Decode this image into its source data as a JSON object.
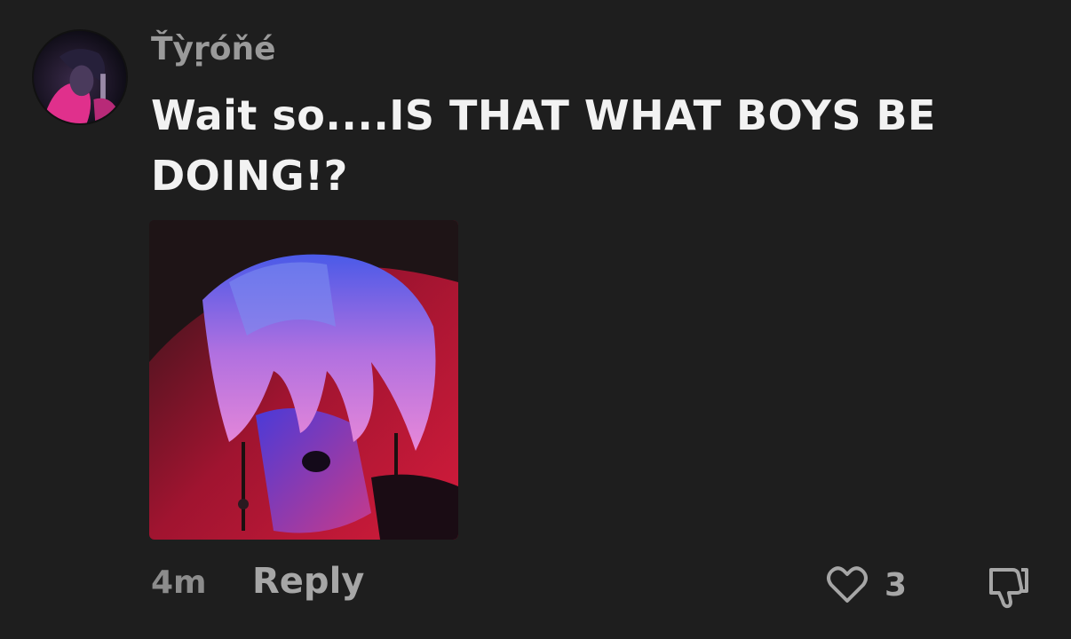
{
  "comment": {
    "username": "Ťỳṛóňé",
    "text": "Wait so....IS THAT WHAT BOYS BE DOING!?",
    "time": "4m",
    "reply_label": "Reply",
    "like_count": "3",
    "avatar_icon": "user-avatar-image",
    "attachment_icon": "attached-image",
    "like_icon": "heart-outline-icon",
    "dislike_icon": "thumbs-down-icon"
  },
  "colors": {
    "background": "#1e1e1e",
    "username": "#9a9a9a",
    "text": "#f2f2f2",
    "muted": "#a6a6a6"
  }
}
